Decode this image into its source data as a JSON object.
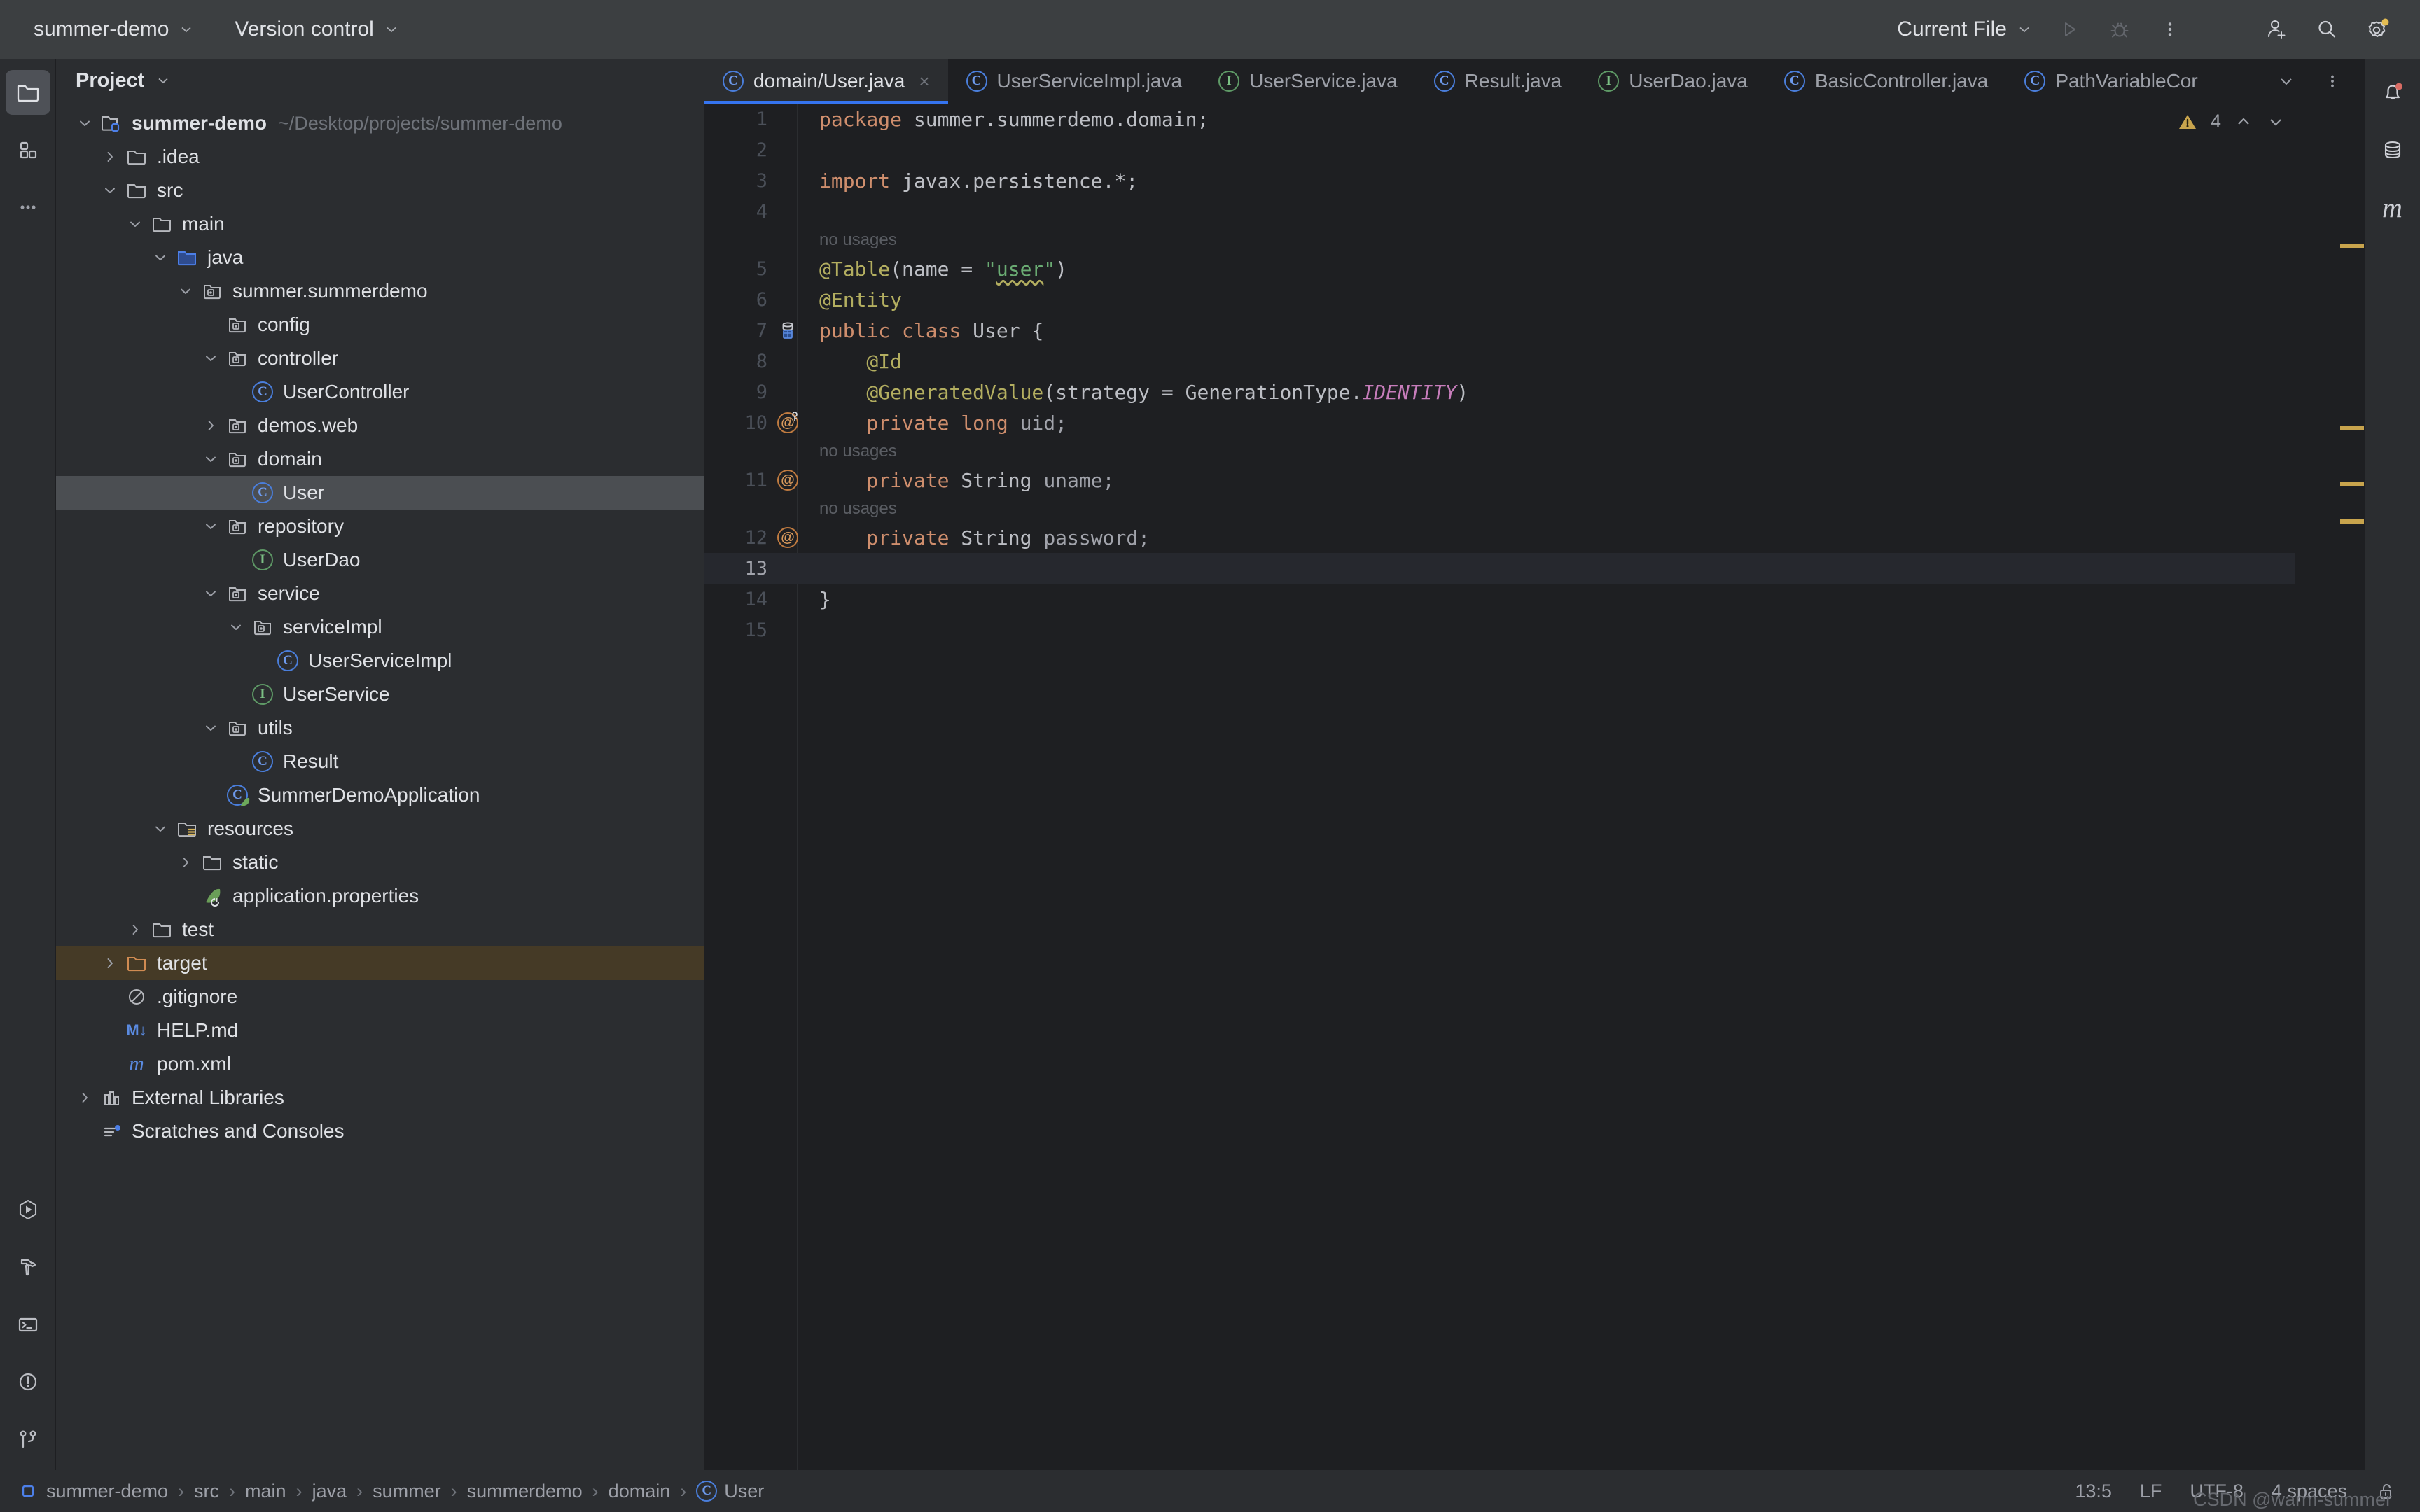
{
  "titlebar": {
    "project_name": "summer-demo",
    "vcs_label": "Version control",
    "run_config": "Current File",
    "chevron": "⌄",
    "icons": {
      "run": "run-icon",
      "debug": "debug-icon",
      "more": "more-vertical-icon",
      "add_user": "add-user-icon",
      "search": "search-icon",
      "settings": "settings-gear-icon"
    }
  },
  "rail_left": {
    "top": [
      "project-icon",
      "structure-icon",
      "more-tool-windows-icon"
    ],
    "bottom": [
      "run-tool-icon",
      "build-hammer-icon",
      "terminal-icon",
      "problems-icon",
      "git-branch-icon"
    ]
  },
  "rail_right": {
    "items": [
      "notifications-bell-icon",
      "database-icon",
      "maven-icon"
    ],
    "maven_glyph": "m"
  },
  "project_panel": {
    "title": "Project",
    "tree": [
      {
        "depth": 0,
        "arrow": "down",
        "icon": "module-folder",
        "label": "summer-demo",
        "bold": true,
        "path": "~/Desktop/projects/summer-demo"
      },
      {
        "depth": 1,
        "arrow": "right",
        "icon": "folder",
        "label": ".idea"
      },
      {
        "depth": 1,
        "arrow": "down",
        "icon": "folder",
        "label": "src"
      },
      {
        "depth": 2,
        "arrow": "down",
        "icon": "folder",
        "label": "main"
      },
      {
        "depth": 3,
        "arrow": "down",
        "icon": "source-folder",
        "label": "java"
      },
      {
        "depth": 4,
        "arrow": "down",
        "icon": "package",
        "label": "summer.summerdemo"
      },
      {
        "depth": 5,
        "arrow": "none",
        "icon": "package",
        "label": "config"
      },
      {
        "depth": 5,
        "arrow": "down",
        "icon": "package",
        "label": "controller"
      },
      {
        "depth": 6,
        "arrow": "none",
        "icon": "class",
        "label": "UserController"
      },
      {
        "depth": 5,
        "arrow": "right",
        "icon": "package",
        "label": "demos.web"
      },
      {
        "depth": 5,
        "arrow": "down",
        "icon": "package",
        "label": "domain"
      },
      {
        "depth": 6,
        "arrow": "none",
        "icon": "class",
        "label": "User",
        "selected": true
      },
      {
        "depth": 5,
        "arrow": "down",
        "icon": "package",
        "label": "repository"
      },
      {
        "depth": 6,
        "arrow": "none",
        "icon": "interface",
        "label": "UserDao"
      },
      {
        "depth": 5,
        "arrow": "down",
        "icon": "package",
        "label": "service"
      },
      {
        "depth": 6,
        "arrow": "down",
        "icon": "package",
        "label": "serviceImpl"
      },
      {
        "depth": 7,
        "arrow": "none",
        "icon": "class",
        "label": "UserServiceImpl"
      },
      {
        "depth": 6,
        "arrow": "none",
        "icon": "interface",
        "label": "UserService"
      },
      {
        "depth": 5,
        "arrow": "down",
        "icon": "package",
        "label": "utils"
      },
      {
        "depth": 6,
        "arrow": "none",
        "icon": "class",
        "label": "Result"
      },
      {
        "depth": 5,
        "arrow": "none",
        "icon": "spring-class",
        "label": "SummerDemoApplication"
      },
      {
        "depth": 3,
        "arrow": "down",
        "icon": "resource-folder",
        "label": "resources"
      },
      {
        "depth": 4,
        "arrow": "right",
        "icon": "folder",
        "label": "static"
      },
      {
        "depth": 4,
        "arrow": "none",
        "icon": "spring-leaf",
        "label": "application.properties"
      },
      {
        "depth": 2,
        "arrow": "right",
        "icon": "folder",
        "label": "test"
      },
      {
        "depth": 1,
        "arrow": "right",
        "icon": "excluded-folder",
        "label": "target",
        "highlight": "target"
      },
      {
        "depth": 1,
        "arrow": "none",
        "icon": "gitignore",
        "label": ".gitignore"
      },
      {
        "depth": 1,
        "arrow": "none",
        "icon": "markdown",
        "label": "HELP.md"
      },
      {
        "depth": 1,
        "arrow": "none",
        "icon": "maven-pom",
        "label": "pom.xml"
      },
      {
        "depth": 0,
        "arrow": "right",
        "icon": "libraries",
        "label": "External Libraries"
      },
      {
        "depth": 0,
        "arrow": "none",
        "icon": "scratches",
        "label": "Scratches and Consoles"
      }
    ]
  },
  "editor": {
    "tabs": [
      {
        "label": "domain/User.java",
        "icon": "class",
        "active": true,
        "closable": true
      },
      {
        "label": "UserServiceImpl.java",
        "icon": "class",
        "active": false
      },
      {
        "label": "UserService.java",
        "icon": "interface",
        "active": false
      },
      {
        "label": "Result.java",
        "icon": "class",
        "active": false
      },
      {
        "label": "UserDao.java",
        "icon": "interface",
        "active": false
      },
      {
        "label": "BasicController.java",
        "icon": "class",
        "active": false
      },
      {
        "label": "PathVariableCor",
        "icon": "class",
        "active": false
      }
    ],
    "tab_actions": [
      "tab-list-chevron-icon",
      "tab-more-icon"
    ],
    "inspection": {
      "warning_count": "4",
      "up": "⌃",
      "down": "⌄"
    },
    "lines": [
      {
        "n": "1",
        "tokens": [
          {
            "t": "package ",
            "c": "kw"
          },
          {
            "t": "summer.summerdemo.domain;",
            "c": "pln"
          }
        ]
      },
      {
        "n": "2",
        "tokens": []
      },
      {
        "n": "3",
        "tokens": [
          {
            "t": "import ",
            "c": "kw"
          },
          {
            "t": "javax.persistence.*;",
            "c": "pln"
          }
        ]
      },
      {
        "n": "4",
        "tokens": []
      },
      {
        "hint": "no usages"
      },
      {
        "n": "5",
        "tokens": [
          {
            "t": "@Table",
            "c": "ann"
          },
          {
            "t": "(name = ",
            "c": "pln"
          },
          {
            "t": "\"",
            "c": "str"
          },
          {
            "t": "user",
            "c": "str squiggle"
          },
          {
            "t": "\"",
            "c": "str"
          },
          {
            "t": ")",
            "c": "pln"
          }
        ]
      },
      {
        "n": "6",
        "tokens": [
          {
            "t": "@Entity",
            "c": "ann"
          }
        ]
      },
      {
        "n": "7",
        "gutter": "entity-table-icon",
        "tokens": [
          {
            "t": "public class ",
            "c": "kw"
          },
          {
            "t": "User ",
            "c": "typ"
          },
          {
            "t": "{",
            "c": "pln"
          }
        ]
      },
      {
        "n": "8",
        "tokens": [
          {
            "t": "    @Id",
            "c": "ann"
          }
        ]
      },
      {
        "n": "9",
        "tokens": [
          {
            "t": "    @GeneratedValue",
            "c": "ann"
          },
          {
            "t": "(strategy = GenerationType.",
            "c": "pln"
          },
          {
            "t": "IDENTITY",
            "c": "cst"
          },
          {
            "t": ")",
            "c": "pln"
          }
        ]
      },
      {
        "n": "10",
        "gutter": "annotation-key-icon",
        "tokens": [
          {
            "t": "    private long ",
            "c": "kw"
          },
          {
            "t": "uid;",
            "c": "fld"
          }
        ]
      },
      {
        "hint": "no usages"
      },
      {
        "n": "11",
        "gutter": "annotation-icon",
        "tokens": [
          {
            "t": "    private ",
            "c": "kw"
          },
          {
            "t": "String ",
            "c": "typ"
          },
          {
            "t": "uname;",
            "c": "fld"
          }
        ]
      },
      {
        "hint": "no usages"
      },
      {
        "n": "12",
        "gutter": "annotation-icon",
        "tokens": [
          {
            "t": "    private ",
            "c": "kw"
          },
          {
            "t": "String ",
            "c": "typ"
          },
          {
            "t": "password;",
            "c": "fld"
          }
        ]
      },
      {
        "n": "13",
        "tokens": [],
        "current": true
      },
      {
        "n": "14",
        "tokens": [
          {
            "t": "}",
            "c": "pln"
          }
        ]
      },
      {
        "n": "15",
        "tokens": []
      }
    ],
    "stripes_top": [
      200,
      460,
      540,
      594
    ]
  },
  "statusbar": {
    "breadcrumbs": [
      "summer-demo",
      "src",
      "main",
      "java",
      "summer",
      "summerdemo",
      "domain",
      "User"
    ],
    "breadcrumb_last_icon": "class",
    "separator": "›",
    "caret": "13:5",
    "line_sep": "LF",
    "encoding": "UTF-8",
    "indent": "4 spaces",
    "lock_icon": "unlocked-icon"
  },
  "watermark": "CSDN @warm-summer",
  "colors": {
    "accent": "#3574F0",
    "warning": "#C8A44D",
    "titlebar_bg": "#3C3F41",
    "panel_bg": "#2B2D30",
    "editor_bg": "#1E1F22",
    "selection": "#4B4E52",
    "target_highlight": "#453A26"
  }
}
